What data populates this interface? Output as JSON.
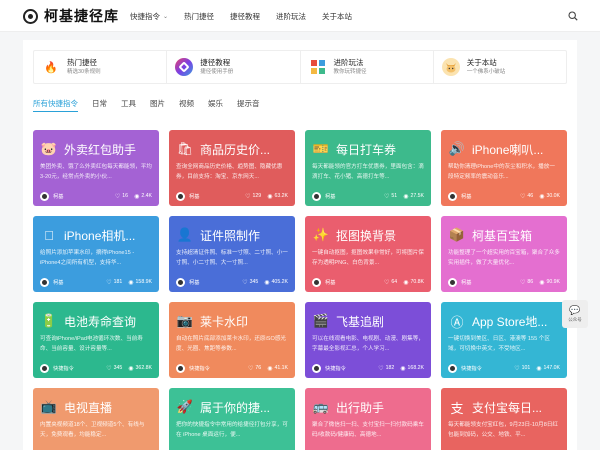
{
  "site": {
    "name": "柯基捷径库"
  },
  "nav": [
    {
      "label": "快捷指令",
      "has_dropdown": true
    },
    {
      "label": "热门捷径",
      "has_dropdown": false
    },
    {
      "label": "捷径教程",
      "has_dropdown": false
    },
    {
      "label": "进阶玩法",
      "has_dropdown": false
    },
    {
      "label": "关于本站",
      "has_dropdown": false
    }
  ],
  "icons": {
    "search": "search-icon",
    "dropdown": "chevron-down-icon",
    "chat": "chat-icon"
  },
  "top_cards": [
    {
      "title": "热门捷径",
      "subtitle": "精选30条规则",
      "icon": "flame-icon",
      "color": "#f15a24"
    },
    {
      "title": "捷径教程",
      "subtitle": "捷径使用手册",
      "icon": "shortcuts-icon",
      "color": "#7b3fe4"
    },
    {
      "title": "进阶玩法",
      "subtitle": "教你玩转捷径",
      "icon": "puzzle-icon",
      "color": "#e74c3c"
    },
    {
      "title": "关于本站",
      "subtitle": "一个佛系小破站",
      "icon": "corgi-icon",
      "color": "#f4b942"
    }
  ],
  "tabs": [
    {
      "label": "所有快捷指令",
      "active": true
    },
    {
      "label": "日常",
      "active": false
    },
    {
      "label": "工具",
      "active": false
    },
    {
      "label": "图片",
      "active": false
    },
    {
      "label": "视频",
      "active": false
    },
    {
      "label": "娱乐",
      "active": false
    },
    {
      "label": "提示音",
      "active": false
    }
  ],
  "cards": [
    {
      "title": "外卖红包助手",
      "desc": "美团外卖、饿了么外卖红包每天都能领，平均3-20元，经常点外卖的小伙...",
      "author": "柯基",
      "likes": "16",
      "views": "2.4K",
      "icon": "pig-icon",
      "color": "#a462d4"
    },
    {
      "title": "商品历史价...",
      "desc": "查询全网商品历史价格、趋势图、隐藏优惠券，目前支持：淘宝、京东网天...",
      "author": "柯基",
      "likes": "129",
      "views": "63.2K",
      "icon": "shop-icon",
      "color": "#e05c5c"
    },
    {
      "title": "每日打车券",
      "desc": "每天都能领的官方打车优惠券，里面包含：滴滴打车、花小猪、高德打车等...",
      "author": "柯基",
      "likes": "51",
      "views": "27.5K",
      "icon": "ticket-icon",
      "color": "#3dba8c"
    },
    {
      "title": "iPhone喇叭...",
      "desc": "帮助你清理iPhone中的灰尘和积水，播放一段特定频率的震动音乐...",
      "author": "柯基",
      "likes": "46",
      "views": "30.0K",
      "icon": "speaker-icon",
      "color": "#f0775b"
    },
    {
      "title": "iPhone相机...",
      "desc": "给照片添加苹果水印，摘得iPhone15 - iPhone4之间所有机型，支持华...",
      "author": "柯基",
      "likes": "181",
      "views": "158.9K",
      "icon": "apple-icon",
      "color": "#3c9dde"
    },
    {
      "title": "证件照制作",
      "desc": "支持超清证件照、标准一寸照、二寸照、小一寸照、小二寸照、大一寸照...",
      "author": "柯基",
      "likes": "345",
      "views": "405.2K",
      "icon": "person-icon",
      "color": "#4a6ed8"
    },
    {
      "title": "抠图换背景",
      "desc": "一键自动抠图，抠图效果非常好，可将图片保存为透明PNG、白色背景...",
      "author": "柯基",
      "likes": "64",
      "views": "70.8K",
      "icon": "wand-icon",
      "color": "#ea5e6e"
    },
    {
      "title": "柯基百宝箱",
      "desc": "功能整理了一个超实用的百宝箱，聚合了众多实用插件，做了大量优化...",
      "author": "柯基",
      "likes": "86",
      "views": "90.9K",
      "icon": "box-icon",
      "color": "#e46fd0"
    },
    {
      "title": "电池寿命查询",
      "desc": "可查询iPhone/iPad电池循环次数、当前寿命、当前容量、设计容量等...",
      "author": "快捷指令",
      "likes": "345",
      "views": "362.8K",
      "icon": "battery-icon",
      "color": "#2cb88e"
    },
    {
      "title": "莱卡水印",
      "desc": "自动在照片底部添加莱卡水印，还原iSO感光度、光圈、焦距等参数...",
      "author": "快捷指令",
      "likes": "76",
      "views": "41.1K",
      "icon": "camera-icon",
      "color": "#f08a5d"
    },
    {
      "title": "飞基追剧",
      "desc": "可以在线观看电影、电视剧、动漫、剧集等，字幕最全影视汇总，个人学习...",
      "author": "快捷指令",
      "likes": "182",
      "views": "168.2K",
      "icon": "film-icon",
      "color": "#7c4ed8"
    },
    {
      "title": "App Store地...",
      "desc": "一键切换到美区、日区、港澳等 155 个区域，可切换中英文，不受地区...",
      "author": "快捷指令",
      "likes": "101",
      "views": "147.0K",
      "icon": "appstore-icon",
      "color": "#34b6d4"
    },
    {
      "title": "电视直播",
      "desc": "内置央视频道18个、卫视频道5个、有线与天，免费观看，均能稳定...",
      "author": "快捷指令",
      "likes": "",
      "views": "",
      "icon": "tv-icon",
      "color": "#f09a6e"
    },
    {
      "title": "属于你的捷...",
      "desc": "把你的快捷指令中常用的给捷径打包分享，可在 iPhone 桌面运行，便...",
      "author": "快捷指令",
      "likes": "",
      "views": "",
      "icon": "rocket-icon",
      "color": "#3dc196"
    },
    {
      "title": "出行助手",
      "desc": "聚合了微信扫一扫、支付宝扫一扫付款码乘车码/收款码/健康码、高德地...",
      "author": "快捷指令",
      "likes": "",
      "views": "",
      "icon": "bus-icon",
      "color": "#ee6c8e"
    },
    {
      "title": "支付宝每日...",
      "desc": "每天都能领支付宝红包，9月23日-10月8日红包能到加码，公交、地铁、平...",
      "author": "快捷指令",
      "likes": "",
      "views": "",
      "icon": "alipay-icon",
      "color": "#e86460"
    }
  ],
  "float_chat": {
    "label": "公众号"
  }
}
